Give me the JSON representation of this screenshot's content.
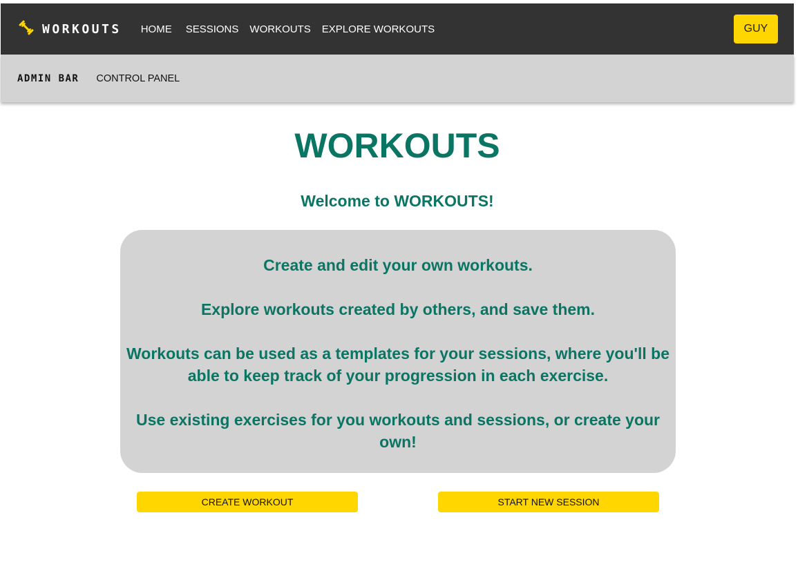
{
  "header": {
    "brand": "WORKOUTS",
    "brand_icon": "dumbbell-icon",
    "accent_color": "#ffd600",
    "nav": [
      {
        "label": "HOME"
      },
      {
        "label": "SESSIONS"
      },
      {
        "label": "WORKOUTS"
      },
      {
        "label": "EXPLORE WORKOUTS"
      }
    ],
    "user_button": "GUY"
  },
  "admin_bar": {
    "title": "ADMIN BAR",
    "link": "CONTROL PANEL"
  },
  "main": {
    "title": "WORKOUTS",
    "welcome": "Welcome to WORKOUTS!",
    "paragraphs": [
      "Create and edit your own workouts.",
      "Explore workouts created by others, and save them.",
      "Workouts can be used as a templates for your sessions, where you'll be able to keep track of your progression in each exercise.",
      "Use existing exercises for you workouts and sessions, or create your own!"
    ],
    "text_color": "#0b7564",
    "buttons": {
      "create": "CREATE WORKOUT",
      "session": "START NEW SESSION"
    }
  }
}
